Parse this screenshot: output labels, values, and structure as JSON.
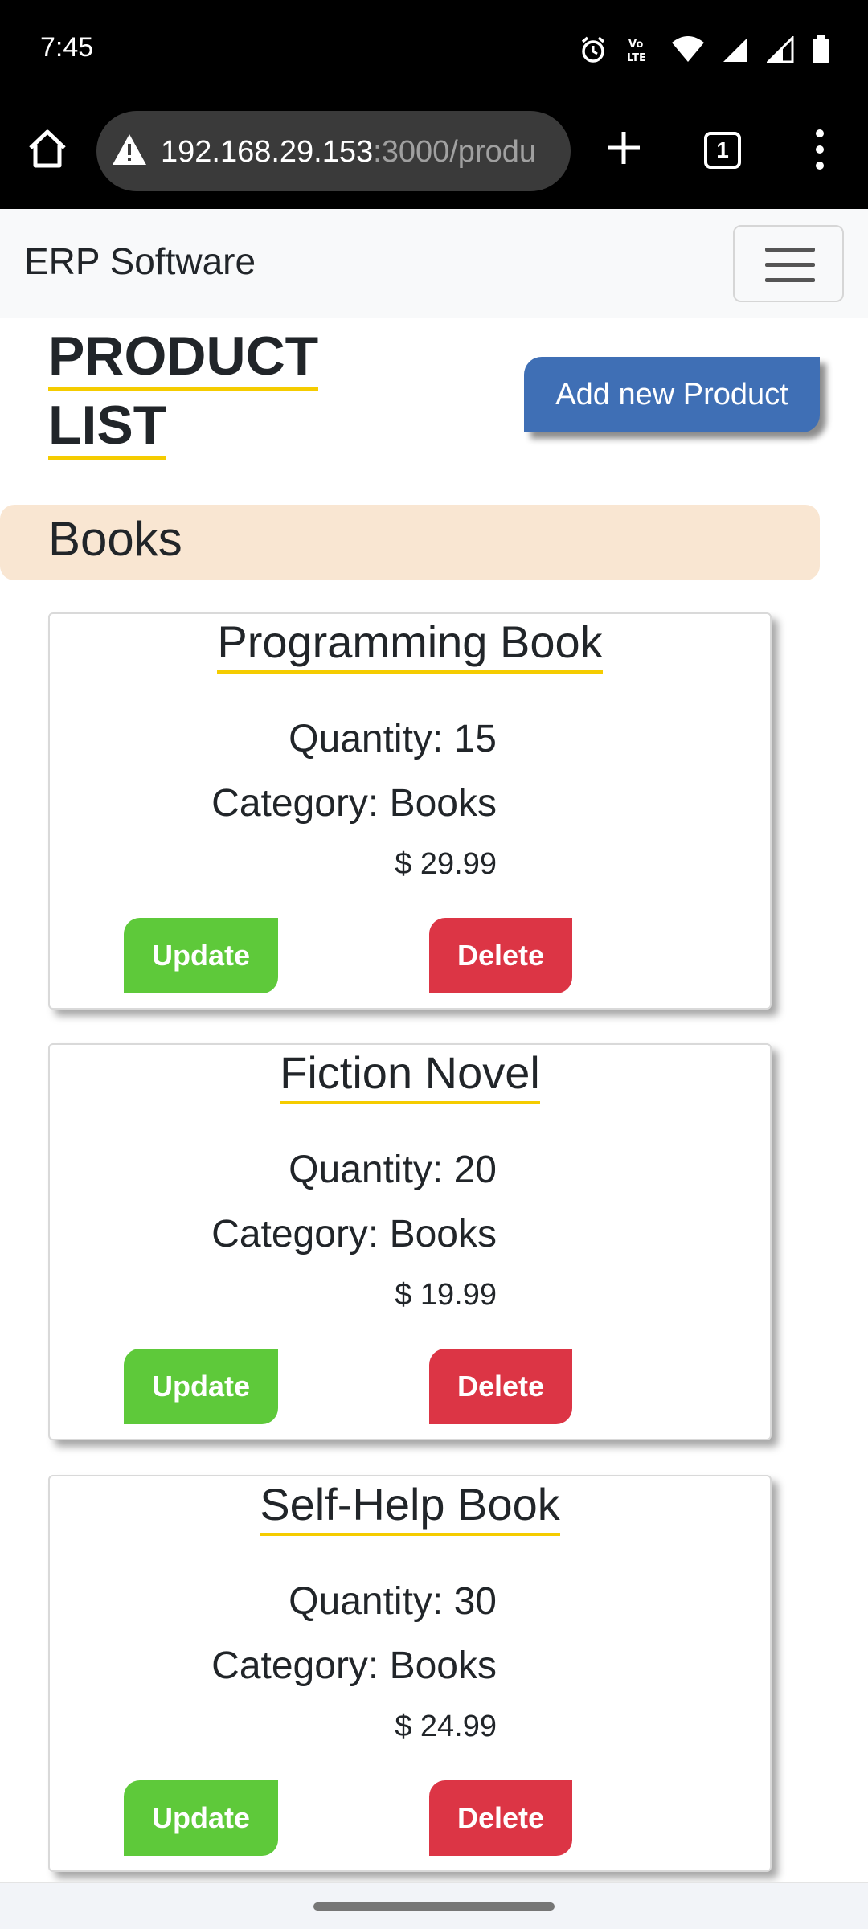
{
  "status_bar": {
    "time": "7:45",
    "icons": [
      "alarm-icon",
      "volte-icon",
      "wifi-icon",
      "signal-icon",
      "signal-icon-2",
      "battery-icon"
    ]
  },
  "browser": {
    "url_host": "192.168.29.153",
    "url_rest": ":3000/produ",
    "tab_count": "1"
  },
  "navbar": {
    "brand": "ERP Software"
  },
  "header": {
    "title_line1": "PRODUCT",
    "title_line2": "LIST",
    "add_button": "Add new Product"
  },
  "category": {
    "name": "Books"
  },
  "products": [
    {
      "name": "Programming Book",
      "quantity": "Quantity: 15",
      "category": "Category: Books",
      "price": "$ 29.99",
      "update": "Update",
      "delete": "Delete"
    },
    {
      "name": "Fiction Novel",
      "quantity": "Quantity: 20",
      "category": "Category: Books",
      "price": "$ 19.99",
      "update": "Update",
      "delete": "Delete"
    },
    {
      "name": "Self-Help Book",
      "quantity": "Quantity: 30",
      "category": "Category: Books",
      "price": "$ 24.99",
      "update": "Update",
      "delete": "Delete"
    }
  ],
  "colors": {
    "accent_underline": "#f5cc00",
    "primary": "#3f6fb5",
    "update": "#5ec93a",
    "delete": "#dc3545",
    "category_banner": "#f9e6d2"
  }
}
